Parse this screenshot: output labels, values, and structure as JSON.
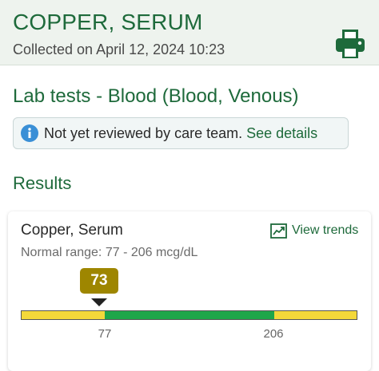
{
  "header": {
    "title": "COPPER, SERUM",
    "collected": "Collected on April 12, 2024 10:23",
    "print_icon": "printer-icon"
  },
  "section": {
    "title": "Lab tests - Blood (Blood, Venous)"
  },
  "notice": {
    "icon": "info-icon",
    "text": "Not yet reviewed by care team.",
    "link": "See details"
  },
  "results": {
    "title": "Results",
    "card": {
      "test_name": "Copper, Serum",
      "trends_label": "View trends",
      "trends_icon": "trend-chart-icon",
      "normal_range": "Normal range: 77 - 206 mcg/dL",
      "value": "73",
      "low_tick": "77",
      "high_tick": "206",
      "colors": {
        "abnormal": "#f4d83a",
        "normal": "#1ea64a",
        "value_badge": "#9e8600",
        "accent": "#1e6a3b"
      }
    }
  }
}
